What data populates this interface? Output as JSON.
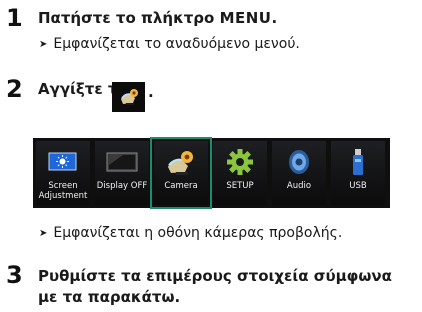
{
  "steps": [
    {
      "number": "1",
      "text_pre": "Πατήστε το πλήκτρο ",
      "key": "MENU",
      "text_post": "."
    },
    {
      "number": "2",
      "text_pre": "Αγγίξτε το",
      "text_post": "."
    },
    {
      "number": "3",
      "line1": "Ρυθμίστε τα επιμέρους στοιχεία σύμφωνα",
      "line2": "με τα παρακάτω."
    }
  ],
  "results": [
    "Εμφανίζεται το αναδυόμενο μενού.",
    "Εμφανίζεται η οθόνη κάμερας προβολής."
  ],
  "result_marker": "➤",
  "menu": {
    "items": [
      {
        "label1": "Screen",
        "label2": "Adjustment",
        "icon": "screen-adjust-icon"
      },
      {
        "label1": "Display OFF",
        "icon": "display-off-icon"
      },
      {
        "label1": "Camera",
        "icon": "camera-icon",
        "selected": true
      },
      {
        "label1": "SETUP",
        "icon": "gear-icon"
      },
      {
        "label1": "Audio",
        "icon": "speaker-icon"
      },
      {
        "label1": "USB",
        "icon": "usb-icon"
      }
    ],
    "highlight_color": "#1e8a6e"
  }
}
